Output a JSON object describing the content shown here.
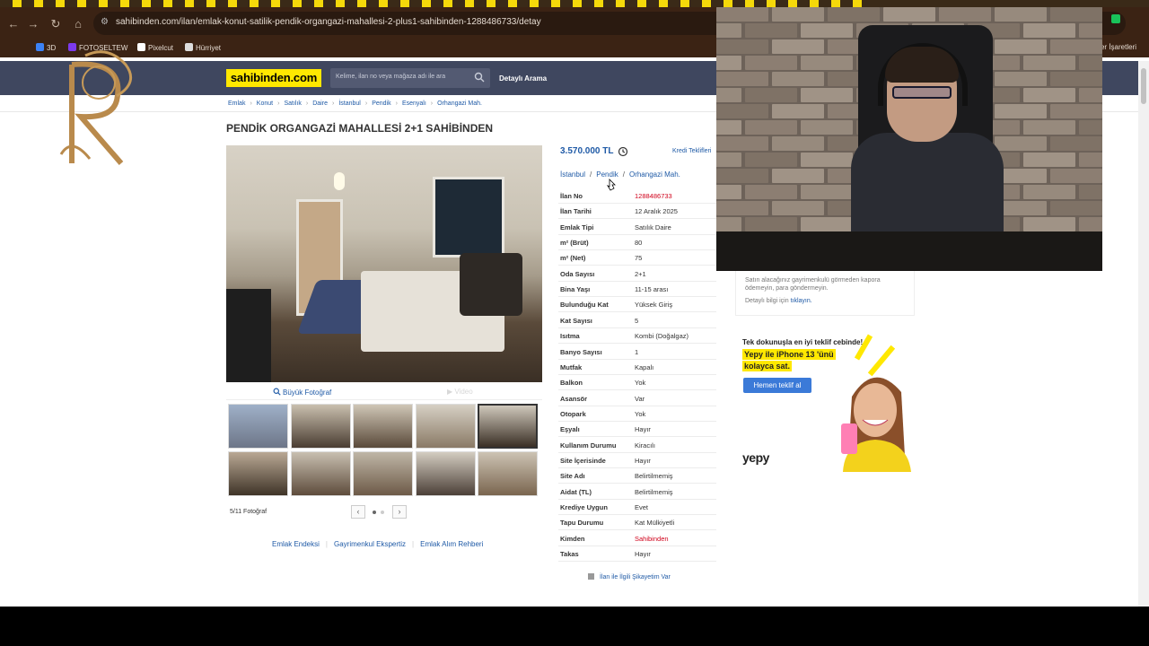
{
  "browser": {
    "url": "sahibinden.com/ilan/emlak-konut-satilik-pendik-organgazi-mahallesi-2-plus1-sahibinden-1288486733/detay",
    "bookmarks": [
      {
        "label": "3D",
        "color": "#3b82f6"
      },
      {
        "label": "FOTOSELTEW",
        "color": "#7c3aed"
      },
      {
        "label": "Pixelcut",
        "color": "#ffffff"
      },
      {
        "label": "Hürriyet",
        "color": "#dddddd"
      }
    ],
    "bookmarks_right": "Yer İşaretleri"
  },
  "header": {
    "logo": "sahibinden.com",
    "search_placeholder": "Kelime, ilan no veya mağaza adı ile ara",
    "detailed_search": "Detaylı Arama"
  },
  "breadcrumb": [
    "Emlak",
    "Konut",
    "Satılık",
    "Daire",
    "İstanbul",
    "Pendik",
    "Esenyalı",
    "Orhangazi Mah."
  ],
  "listing": {
    "title": "PENDİK ORGANGAZİ MAHALLESİ 2+1 SAHİBİNDEN",
    "price": "3.570.000 TL",
    "credit_offers": "Kredi Teklifleri",
    "location": [
      "İstanbul",
      "Pendik",
      "Orhangazi Mah."
    ],
    "big_photo": "Büyük Fotoğraf",
    "video": "Video",
    "photo_count": "5/11 Fotoğraf",
    "thumbnail_count": 10,
    "active_thumbnail": 5,
    "specs": [
      {
        "k": "İlan No",
        "v": "1288486733",
        "red": true
      },
      {
        "k": "İlan Tarihi",
        "v": "12 Aralık 2025"
      },
      {
        "k": "Emlak Tipi",
        "v": "Satılık Daire"
      },
      {
        "k": "m² (Brüt)",
        "v": "80"
      },
      {
        "k": "m² (Net)",
        "v": "75"
      },
      {
        "k": "Oda Sayısı",
        "v": "2+1"
      },
      {
        "k": "Bina Yaşı",
        "v": "11-15 arası"
      },
      {
        "k": "Bulunduğu Kat",
        "v": "Yüksek Giriş"
      },
      {
        "k": "Kat Sayısı",
        "v": "5"
      },
      {
        "k": "Isıtma",
        "v": "Kombi (Doğalgaz)"
      },
      {
        "k": "Banyo Sayısı",
        "v": "1"
      },
      {
        "k": "Mutfak",
        "v": "Kapalı"
      },
      {
        "k": "Balkon",
        "v": "Yok"
      },
      {
        "k": "Asansör",
        "v": "Var"
      },
      {
        "k": "Otopark",
        "v": "Yok"
      },
      {
        "k": "Eşyalı",
        "v": "Hayır"
      },
      {
        "k": "Kullanım Durumu",
        "v": "Kiracılı"
      },
      {
        "k": "Site İçerisinde",
        "v": "Hayır"
      },
      {
        "k": "Site Adı",
        "v": "Belirtilmemiş"
      },
      {
        "k": "Aidat (TL)",
        "v": "Belirtilmemiş"
      },
      {
        "k": "Krediye Uygun",
        "v": "Evet"
      },
      {
        "k": "Tapu Durumu",
        "v": "Kat Mülkiyetli"
      },
      {
        "k": "Kimden",
        "v": "Sahibinden",
        "red": true
      },
      {
        "k": "Takas",
        "v": "Hayır"
      }
    ],
    "complaint": "İlan ile İlgili Şikayetim Var"
  },
  "footer_links": [
    "Emlak Endeksi",
    "Gayrimenkul Ekspertiz",
    "Emlak Alım Rehberi"
  ],
  "notice": {
    "text": "Satın alacağınız gayrimenkulü görmeden kapora ödemeyin, para göndermeyin.",
    "more_prefix": "Detaylı bilgi için",
    "more_link": "tıklayın."
  },
  "ad": {
    "line1": "Tek dokunuşla en iyi teklif cebinde!",
    "line2": "Yepy ile iPhone 13 'ünü",
    "line3": "kolayca sat.",
    "button": "Hemen teklif al",
    "brand": "yepy"
  },
  "colors": {
    "header_bg": "#3f475f",
    "logo_yellow": "#ffe800",
    "link_blue": "#1f5aa6",
    "highlight_red": "#d0021b"
  }
}
